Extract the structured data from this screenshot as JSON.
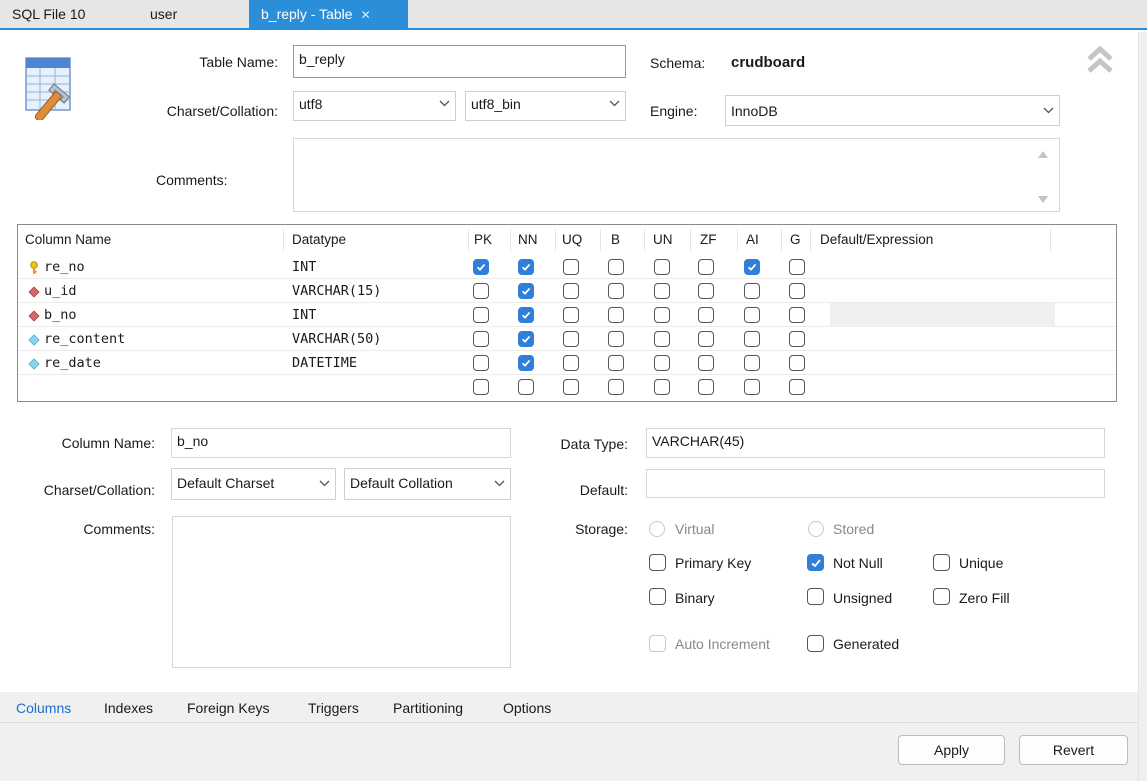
{
  "tabs": [
    {
      "label": "SQL File 10",
      "active": false
    },
    {
      "label": "user",
      "active": false
    },
    {
      "label": "b_reply - Table",
      "active": true
    }
  ],
  "table_form": {
    "table_name_label": "Table Name:",
    "table_name_value": "b_reply",
    "schema_label": "Schema:",
    "schema_value": "crudboard",
    "charset_label": "Charset/Collation:",
    "charset_value": "utf8",
    "collation_value": "utf8_bin",
    "engine_label": "Engine:",
    "engine_value": "InnoDB",
    "comments_label": "Comments:",
    "comments_value": ""
  },
  "grid": {
    "headers": [
      "Column Name",
      "Datatype",
      "PK",
      "NN",
      "UQ",
      "B",
      "UN",
      "ZF",
      "AI",
      "G",
      "Default/Expression"
    ],
    "rows": [
      {
        "name": "re_no",
        "icon": "key-icon",
        "type": "INT",
        "flags": [
          true,
          true,
          false,
          false,
          false,
          false,
          true,
          false
        ]
      },
      {
        "name": "u_id",
        "icon": "red-diamond-icon",
        "type": "VARCHAR(15)",
        "flags": [
          false,
          true,
          false,
          false,
          false,
          false,
          false,
          false
        ]
      },
      {
        "name": "b_no",
        "icon": "red-diamond-icon",
        "type": "INT",
        "flags": [
          false,
          true,
          false,
          false,
          false,
          false,
          false,
          false
        ]
      },
      {
        "name": "re_content",
        "icon": "blue-diamond-icon",
        "type": "VARCHAR(50)",
        "flags": [
          false,
          true,
          false,
          false,
          false,
          false,
          false,
          false
        ]
      },
      {
        "name": "re_date",
        "icon": "blue-diamond-icon",
        "type": "DATETIME",
        "flags": [
          false,
          true,
          false,
          false,
          false,
          false,
          false,
          false
        ]
      },
      {
        "name": "",
        "icon": "",
        "type": "",
        "flags": [
          false,
          false,
          false,
          false,
          false,
          false,
          false,
          false
        ]
      }
    ]
  },
  "details": {
    "column_name_label": "Column Name:",
    "column_name_value": "b_no",
    "charset_label": "Charset/Collation:",
    "charset_value": "Default Charset",
    "collation_value": "Default Collation",
    "comments_label": "Comments:",
    "data_type_label": "Data Type:",
    "data_type_value": "VARCHAR(45)",
    "default_label": "Default:",
    "default_value": "",
    "storage_label": "Storage:",
    "virtual_label": "Virtual",
    "stored_label": "Stored",
    "primary_key_label": "Primary Key",
    "not_null_label": "Not Null",
    "unique_label": "Unique",
    "binary_label": "Binary",
    "unsigned_label": "Unsigned",
    "zero_fill_label": "Zero Fill",
    "auto_increment_label": "Auto Increment",
    "generated_label": "Generated",
    "not_null_checked": true
  },
  "bottom_tabs": [
    "Columns",
    "Indexes",
    "Foreign Keys",
    "Triggers",
    "Partitioning",
    "Options"
  ],
  "buttons": {
    "apply": "Apply",
    "revert": "Revert"
  },
  "colors": {
    "accent": "#2b8ed8",
    "check": "#2f7ed8"
  }
}
